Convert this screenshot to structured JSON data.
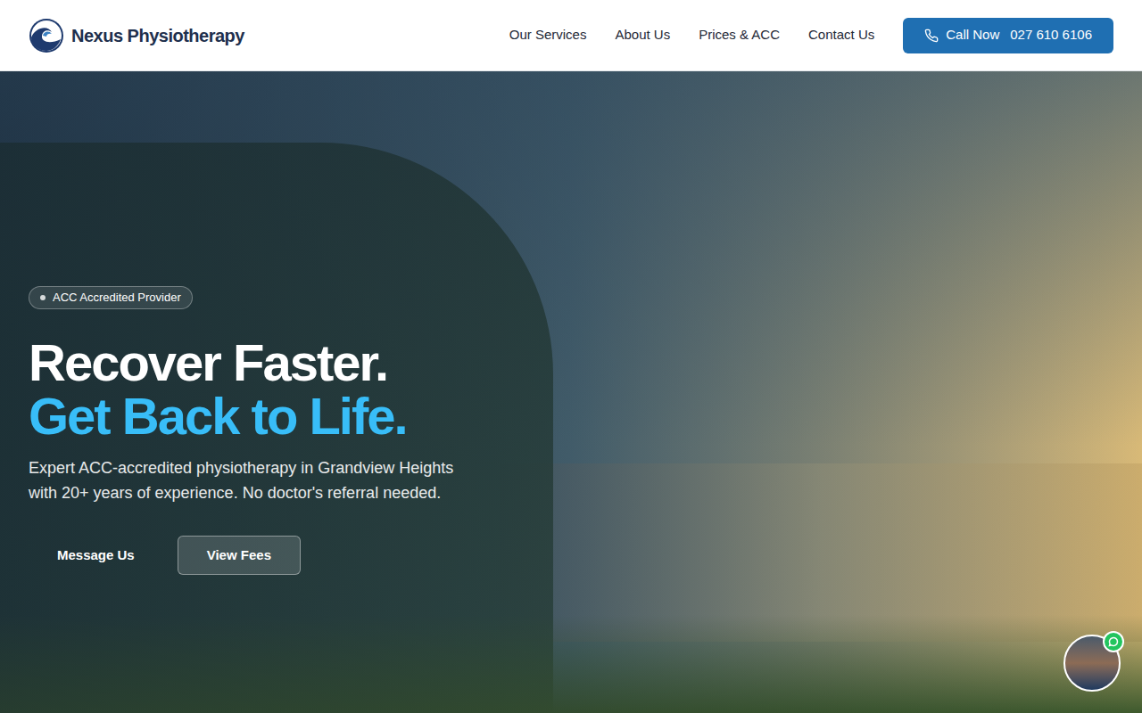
{
  "logo": {
    "name": "Nexus Physiotherapy"
  },
  "nav": [
    {
      "label": "Our Services"
    },
    {
      "label": "About Us"
    },
    {
      "label": "Prices & ACC"
    },
    {
      "label": "Contact Us"
    }
  ],
  "call_button": {
    "label": "Call Now",
    "phone": "027 610 6106"
  },
  "hero": {
    "badge": "ACC Accredited Provider",
    "heading_line1": "Recover Faster.",
    "heading_line2": "Get Back to Life.",
    "description": "Expert ACC-accredited physiotherapy in Grandview Heights with 20+ years of experience. No doctor's referral needed.",
    "buttons": [
      "Message Us",
      "View Fees"
    ]
  },
  "chat_widget": {
    "online": true
  }
}
